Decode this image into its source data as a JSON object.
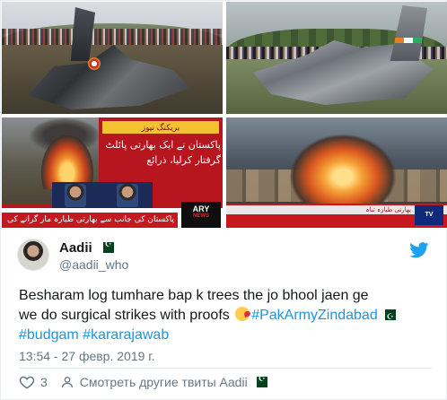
{
  "media": {
    "tile3": {
      "urdu_top": "بریکنگ نیوز",
      "urdu_headline": "پاکستان نے ایک بھارتی پائلٹ گرفتار کرلیا، ذرائع",
      "urdu_bottom_bar": "پاکستان کی جانب سے بھارتی طیارہ مار گرانے کی اطلاعات",
      "channel_logo": "ARY",
      "channel_sub": "NEWS"
    },
    "tile4": {
      "strip_text": "بھارتی طیارہ تباہ",
      "channel_logo": "TV"
    }
  },
  "author": {
    "display_name": "Aadii",
    "handle": "@aadii_who",
    "avatar_icon": "user-avatar",
    "verified_flag_icon": "pakistan-flag-icon"
  },
  "tweet": {
    "line1": "Besharam log tumhare bap k trees the jo bhool jaen ge",
    "line2_prefix": "we do surgical strikes with proofs ",
    "hashtag1": "#PakArmyZindabad",
    "hashtag2": "#budgam",
    "hashtag3": "#kararajawab",
    "timestamp": "13:54 - 27 февр. 2019 г."
  },
  "actions": {
    "like_count": "3",
    "more_tweets_label": "Смотреть другие твиты Aadii"
  },
  "colors": {
    "link": "#1b95e0",
    "secondary_text": "#657786",
    "twitter_blue": "#1da1f2",
    "border": "#e6ecf0"
  }
}
